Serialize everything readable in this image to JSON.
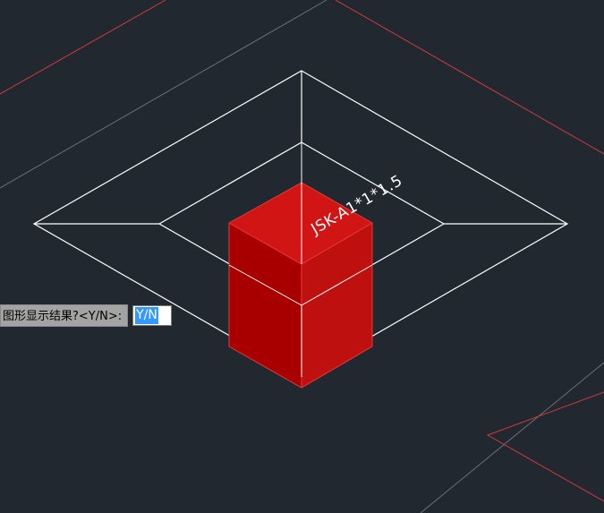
{
  "canvas": {
    "background_color": "#212830",
    "wire_color": "#ffffff",
    "grid_red_color": "#d23a3a",
    "grid_gray_color": "#6b7078",
    "solid_top_color": "#d11414",
    "solid_left_color": "#a80000",
    "solid_right_color": "#bf1010",
    "pit_label": "JSK-A1*1*1.5"
  },
  "command_prompt": {
    "text": "图形显示结果?<Y/N>:",
    "input_value": "Y/N"
  }
}
